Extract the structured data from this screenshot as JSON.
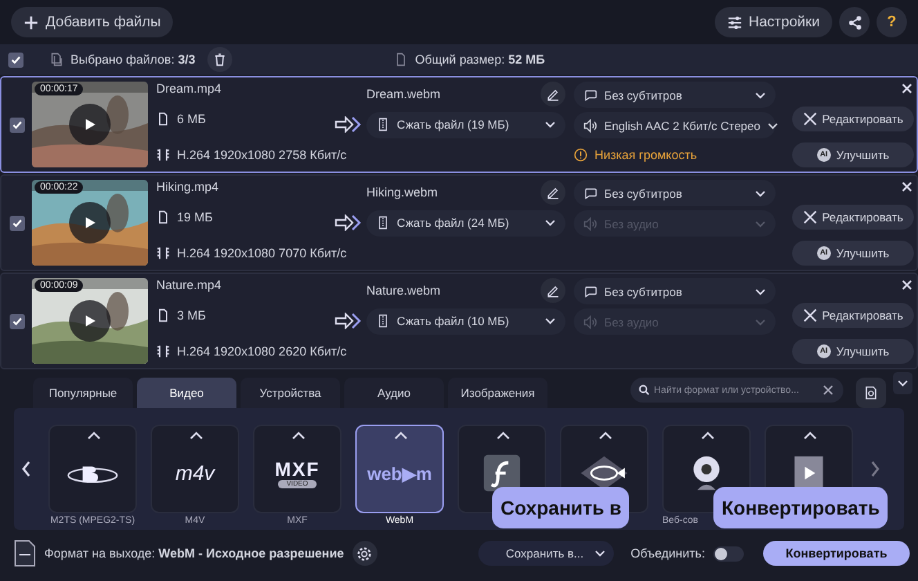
{
  "toolbar": {
    "add_button": "Добавить файлы",
    "settings_button": "Настройки",
    "help_button": "?"
  },
  "selection_bar": {
    "checked": true,
    "selected_text": "Выбрано файлов: **3/3**",
    "total_text": "Общий размер: **52 МБ**"
  },
  "files": [
    {
      "selected": true,
      "checked": true,
      "duration": "00:00:17",
      "name": "Dream.mp4",
      "size": "6 МБ",
      "codec": "H.264 1920x1080 2758 Кбит/с",
      "output_name": "Dream.webm",
      "compress": "Сжать файл (19 МБ)",
      "subtitles": "Без субтитров",
      "audio": "English AAC 2 Кбит/с Стерео",
      "audio_disabled": false,
      "warning": "Низкая громкость",
      "edit_button": "Редактировать",
      "enhance_button": "Улучшить",
      "enhance_badge": "AI"
    },
    {
      "selected": false,
      "checked": true,
      "duration": "00:00:22",
      "name": "Hiking.mp4",
      "size": "19 МБ",
      "codec": "H.264 1920x1080 7070 Кбит/с",
      "output_name": "Hiking.webm",
      "compress": "Сжать файл (24 МБ)",
      "subtitles": "Без субтитров",
      "audio": "Без аудио",
      "audio_disabled": true,
      "edit_button": "Редактировать",
      "enhance_button": "Улучшить",
      "enhance_badge": "AI"
    },
    {
      "selected": false,
      "checked": true,
      "duration": "00:00:09",
      "name": "Nature.mp4",
      "size": "3 МБ",
      "codec": "H.264 1920x1080 2620 Кбит/с",
      "output_name": "Nature.webm",
      "compress": "Сжать файл (10 МБ)",
      "subtitles": "Без субтитров",
      "audio": "Без аудио",
      "audio_disabled": true,
      "edit_button": "Редактировать",
      "enhance_button": "Улучшить",
      "enhance_badge": "AI"
    }
  ],
  "format_tabs": [
    {
      "label": "Популярные",
      "selected": false
    },
    {
      "label": "Видео",
      "selected": true
    },
    {
      "label": "Устройства",
      "selected": false
    },
    {
      "label": "Аудио",
      "selected": false
    },
    {
      "label": "Изображения",
      "selected": false
    }
  ],
  "format_search": {
    "placeholder": "Найти формат или устройство..."
  },
  "formats": [
    {
      "kind": "bluray",
      "label": "M2TS (MPEG2-TS)",
      "selected": false
    },
    {
      "kind": "m4v",
      "logo": "m4v",
      "label": "M4V",
      "selected": false
    },
    {
      "kind": "mxf",
      "logo": "MXF",
      "logo_sub": "VIDEO",
      "label": "MXF",
      "selected": false
    },
    {
      "kind": "webm",
      "logo": "web▶m",
      "label": "WebM",
      "selected": true
    },
    {
      "kind": "flash",
      "selected": false
    },
    {
      "kind": "fish",
      "selected": false
    },
    {
      "kind": "webcam",
      "label": "Веб-сов",
      "selected": false
    },
    {
      "kind": "film",
      "selected": false
    }
  ],
  "bottom_bar": {
    "output_format": "Формат на выходе: **WebM - Исходное разрешение**",
    "save_to": "Сохранить в...",
    "merge_label": "Объединить:",
    "merge_on": false,
    "convert_button": "Конвертировать"
  },
  "tooltips": [
    "Сохранить в",
    "Конвертировать"
  ]
}
